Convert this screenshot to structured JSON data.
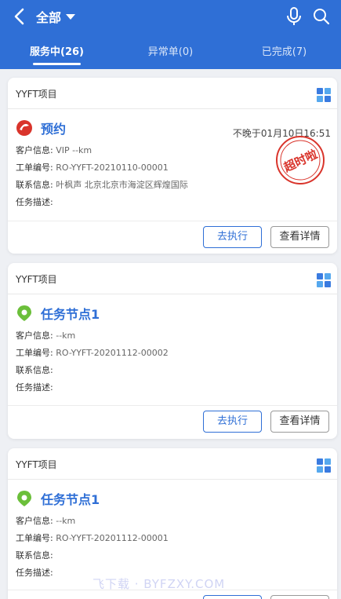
{
  "header": {
    "title": "全部",
    "tabs": [
      {
        "label": "服务中(26)"
      },
      {
        "label": "异常单(0)"
      },
      {
        "label": "已完成(7)"
      }
    ]
  },
  "cards": [
    {
      "project": "YYFT项目",
      "task_name": "预约",
      "deadline": "不晚于01月10日16:51",
      "customer_label": "客户信息:",
      "customer_value": "VIP --km",
      "order_label": "工单编号:",
      "order_value": "RO-YYFT-20210110-00001",
      "contact_label": "联系信息:",
      "contact_value": "叶枫声  北京北京市海淀区辉煌国际",
      "desc_label": "任务描述:",
      "exec_label": "去执行",
      "detail_label": "查看详情",
      "stamp_text": "超时啦"
    },
    {
      "project": "YYFT项目",
      "task_name": "任务节点1",
      "customer_label": "客户信息:",
      "customer_value": "--km",
      "order_label": "工单编号:",
      "order_value": "RO-YYFT-20201112-00002",
      "contact_label": "联系信息:",
      "desc_label": "任务描述:",
      "exec_label": "去执行",
      "detail_label": "查看详情"
    },
    {
      "project": "YYFT项目",
      "task_name": "任务节点1",
      "customer_label": "客户信息:",
      "customer_value": "--km",
      "order_label": "工单编号:",
      "order_value": "RO-YYFT-20201112-00001",
      "contact_label": "联系信息:",
      "desc_label": "任务描述:"
    }
  ],
  "watermark": "飞下载 · BYFZXY.COM",
  "colors": {
    "header_bg": "#2f6fd6",
    "accent": "#2f6fd6",
    "stamp_red": "#d9342b",
    "pin_green": "#6bbf3a"
  }
}
